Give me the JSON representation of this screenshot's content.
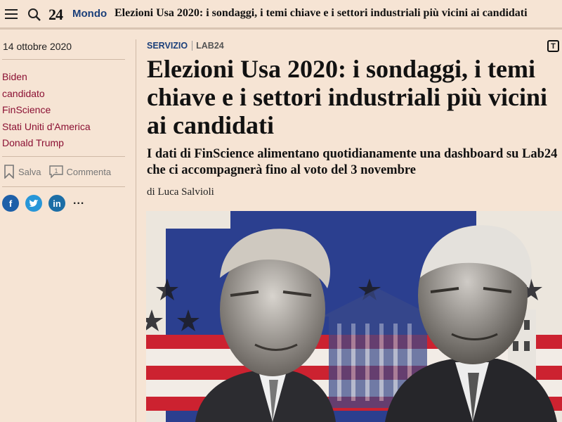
{
  "topbar": {
    "menu_icon": "hamburger-menu-icon",
    "search_icon": "search-icon",
    "logo": "24",
    "section": "Mondo",
    "title": "Elezioni Usa 2020: i sondaggi, i temi chiave e i settori industriali più vicini ai candidati"
  },
  "sidebar": {
    "date": "14 ottobre 2020",
    "tags": [
      "Biden",
      "candidato",
      "FinScience",
      "Stati Uniti d'America",
      "Donald Trump"
    ],
    "save_label": "Salva",
    "comment_count": "1",
    "comment_label": "Commenta",
    "share_icons": [
      "facebook-icon",
      "twitter-icon",
      "linkedin-icon"
    ],
    "more_label": "..."
  },
  "article": {
    "kicker_section": "SERVIZIO",
    "kicker_brand": "LAB24",
    "font_size_label": "T",
    "headline": "Elezioni Usa 2020: i sondaggi, i temi chiave e i settori industriali più vicini ai candidati",
    "standfirst": "I dati di FinScience alimentano quotidianamente una dashboard su Lab24 che ci accompagnerà fino al voto del 3 novembre",
    "byline": "di Luca Salvioli"
  },
  "colors": {
    "background": "#f6e4d4",
    "section_blue": "#1b3f7a",
    "tag_red": "#8b1033",
    "flag_red": "#cc2230",
    "flag_blue": "#2b3f8f"
  }
}
